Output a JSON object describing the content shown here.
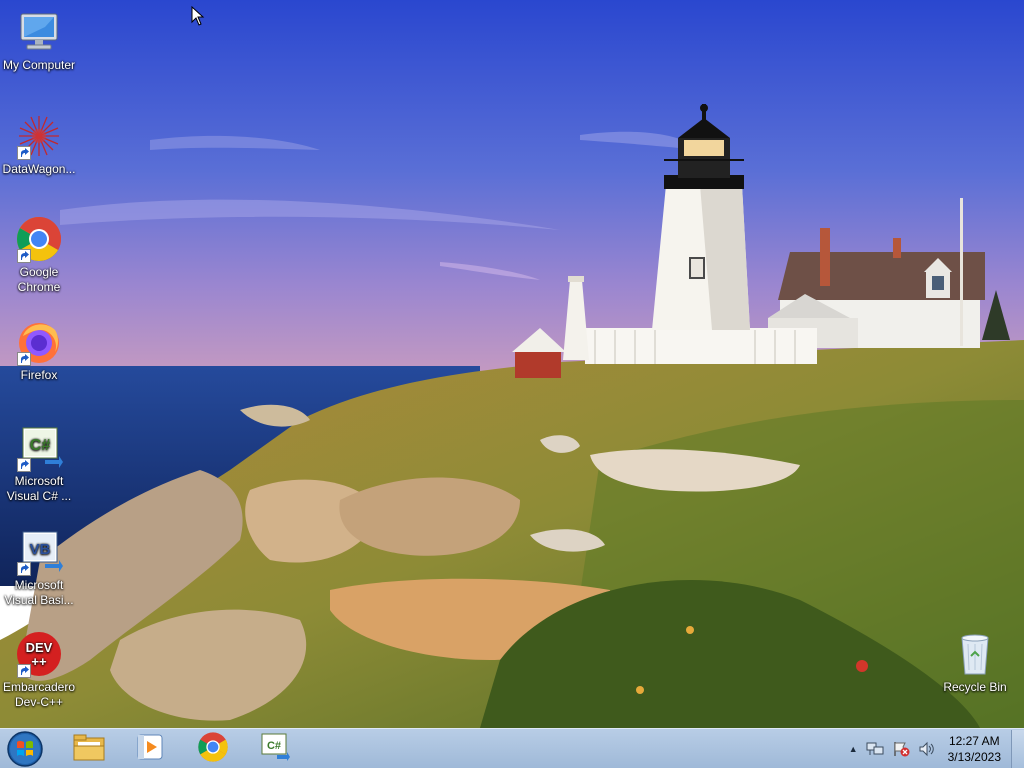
{
  "desktop": {
    "icons": [
      {
        "label_line1": "My Computer",
        "label_line2": ""
      },
      {
        "label_line1": "DataWagon...",
        "label_line2": ""
      },
      {
        "label_line1": "Google",
        "label_line2": "Chrome"
      },
      {
        "label_line1": "Firefox",
        "label_line2": ""
      },
      {
        "label_line1": "Microsoft",
        "label_line2": "Visual C# ..."
      },
      {
        "label_line1": "Microsoft",
        "label_line2": "Visual Basi..."
      },
      {
        "label_line1": "Embarcadero",
        "label_line2": "Dev-C++"
      }
    ],
    "recycle_bin": {
      "label": "Recycle Bin"
    },
    "icon_glyphs": {
      "visual_csharp": "C#",
      "visual_basic": "VB",
      "devcpp": "DEV\n++"
    }
  },
  "taskbar": {
    "pinned": [
      {
        "icon": "file-explorer-icon"
      },
      {
        "icon": "media-player-icon"
      },
      {
        "icon": "chrome-icon"
      },
      {
        "icon": "visual-csharp-icon",
        "glyph": "C#"
      }
    ],
    "clock": {
      "time": "12:27 AM",
      "date": "3/13/2023"
    },
    "tray": {
      "expand_glyph": "▲"
    }
  },
  "colors": {
    "taskbar": "#a9c2df",
    "sky_top": "#2b4fd1",
    "sea": "#1a3f8f",
    "grass": "#8a8a2a"
  }
}
